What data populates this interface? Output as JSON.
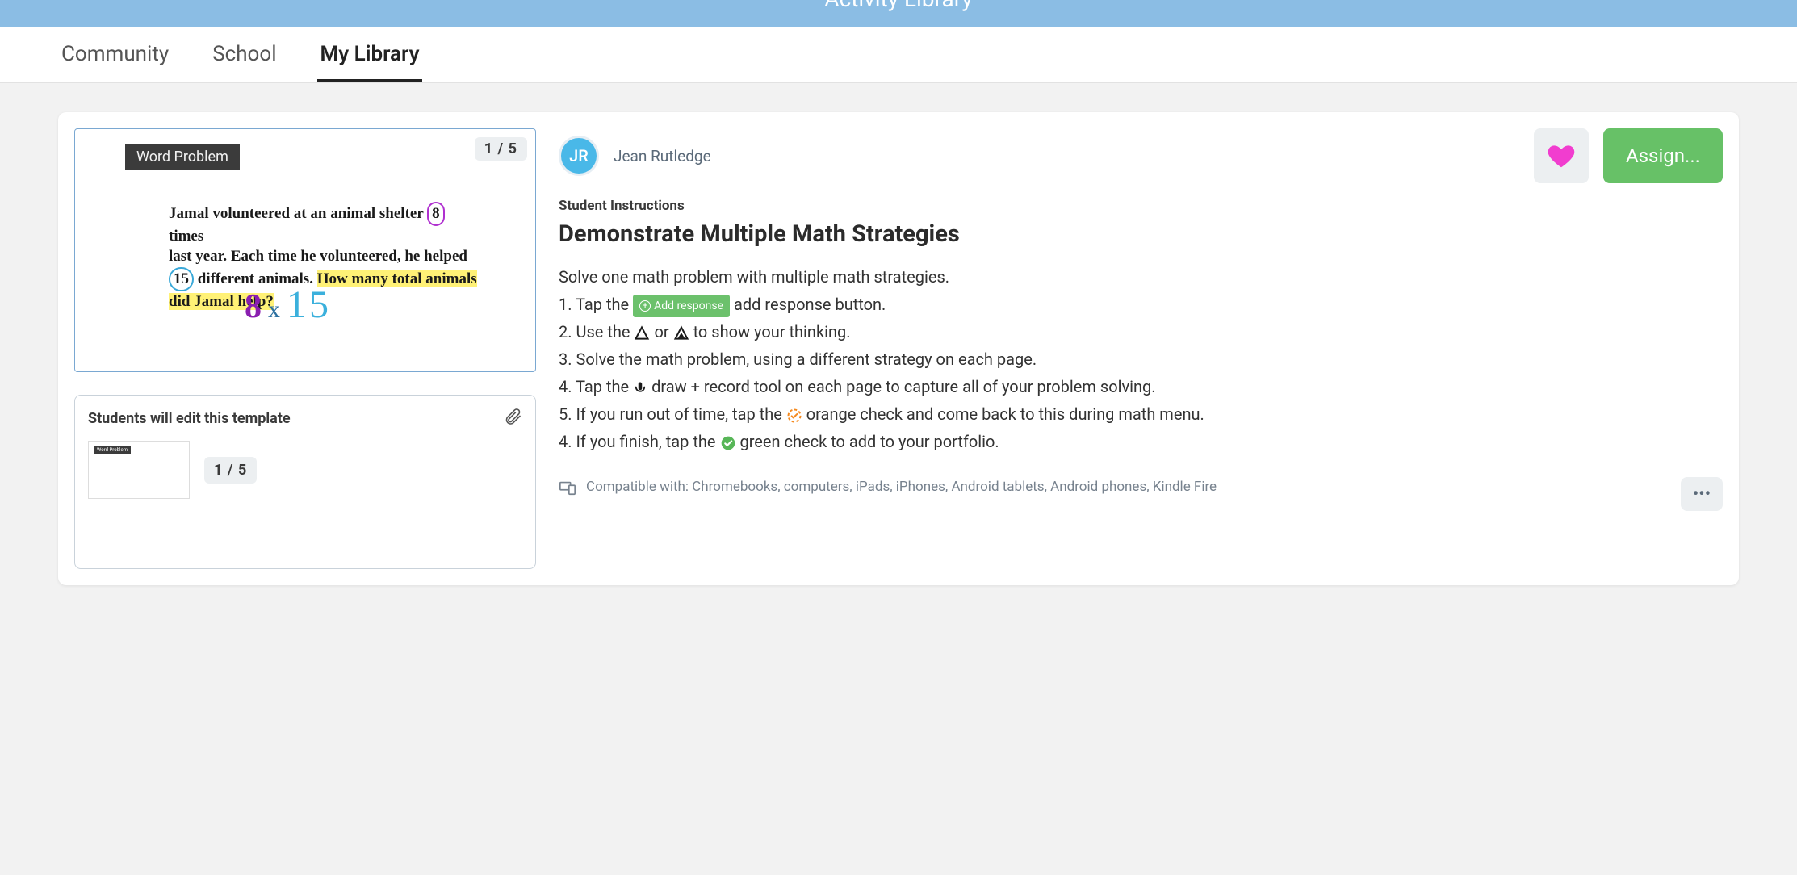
{
  "header": {
    "title": "Activity Library"
  },
  "tabs": {
    "community": "Community",
    "school": "School",
    "mylibrary": "My Library",
    "active": "mylibrary"
  },
  "preview": {
    "page_indicator": "1 / 5",
    "chip": "Word Problem",
    "problem_line1_a": "Jamal volunteered at an animal shelter",
    "problem_num1": "8",
    "problem_line1_b": "times",
    "problem_line2": "last year. Each time he volunteered, he helped",
    "problem_num2": "15",
    "problem_line3_a": "different animals.",
    "problem_hl1": "How many total animals",
    "problem_hl2": "did Jamal help?",
    "eq_a": "8",
    "eq_op": "x",
    "eq_b": "15"
  },
  "template": {
    "title": "Students will edit this template",
    "page_indicator": "1 / 5",
    "thumb_chip": "Word Problem"
  },
  "author": {
    "initials": "JR",
    "name": "Jean Rutledge"
  },
  "actions": {
    "assign": "Assign..."
  },
  "details": {
    "section_label": "Student Instructions",
    "title": "Demonstrate Multiple Math Strategies",
    "intro": "Solve one math problem with multiple math strategies.",
    "step1_a": "1. Tap the ",
    "add_response_label": "Add response",
    "step1_b": " add response button.",
    "step2_a": "2. Use the ",
    "step2_b": " or ",
    "step2_c": " to show your thinking.",
    "step3": "3. Solve the math problem, using a different strategy on each page.",
    "step4_a": "4. Tap the ",
    "step4_b": " draw + record tool on each page to capture all of your problem solving.",
    "step5_a": "5. If you run out of time, tap the ",
    "step5_b": " orange check and come back to this during math menu.",
    "step6_a": "4. If you finish, tap the ",
    "step6_b": " green check to add to your portfolio."
  },
  "footer": {
    "compat": "Compatible with: Chromebooks, computers, iPads, iPhones, Android tablets, Android phones, Kindle Fire"
  }
}
